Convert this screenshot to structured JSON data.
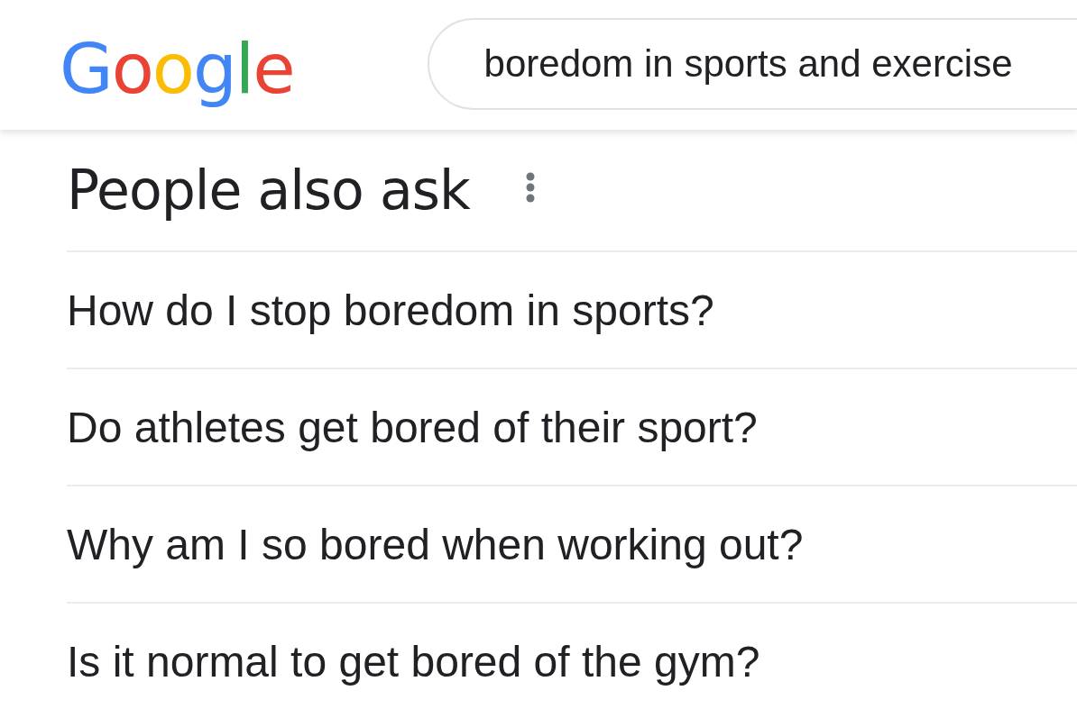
{
  "header": {
    "logo": "Google",
    "search": {
      "value": "boredom in sports and exercise"
    }
  },
  "people_also_ask": {
    "title": "People also ask",
    "questions": [
      "How do I stop boredom in sports?",
      "Do athletes get bored of their sport?",
      "Why am I so bored when working out?",
      "Is it normal to get bored of the gym?"
    ]
  }
}
